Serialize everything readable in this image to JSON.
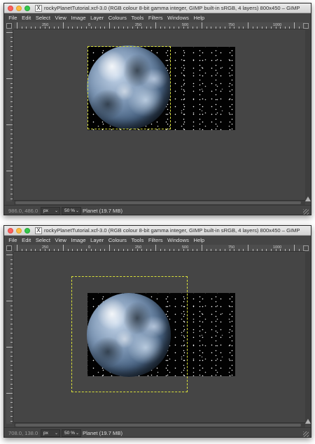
{
  "windows": [
    {
      "title": "rockyPlanetTutorial.xcf-3.0 (RGB colour 8-bit gamma integer, GIMP built-in sRGB, 4 layers) 800x450 – GIMP",
      "app_icon_glyph": "X",
      "menu": [
        "File",
        "Edit",
        "Select",
        "View",
        "Image",
        "Layer",
        "Colours",
        "Tools",
        "Filters",
        "Windows",
        "Help"
      ],
      "ruler_labels": [
        "250",
        "0",
        "250",
        "500",
        "750",
        "1000"
      ],
      "status": {
        "coords": "986.0, 486.0",
        "unit": "px",
        "zoom": "50 %",
        "layer_info": "Planet (19.7 MB)"
      }
    },
    {
      "title": "rockyPlanetTutorial.xcf-3.0 (RGB colour 8-bit gamma integer, GIMP built-in sRGB, 4 layers) 800x450 – GIMP",
      "app_icon_glyph": "X",
      "menu": [
        "File",
        "Edit",
        "Select",
        "View",
        "Image",
        "Layer",
        "Colours",
        "Tools",
        "Filters",
        "Windows",
        "Help"
      ],
      "ruler_labels": [
        "250",
        "0",
        "250",
        "500",
        "750",
        "1000"
      ],
      "status": {
        "coords": "708.0, 138.0",
        "unit": "px",
        "zoom": "50 %",
        "layer_info": "Planet (19.7 MB)"
      }
    }
  ],
  "colors": {
    "window_bg": "#454545",
    "selection_marquee": "#d9e03a",
    "close": "#fc605b",
    "minimize": "#fdbc40",
    "maximize": "#34c84a"
  }
}
